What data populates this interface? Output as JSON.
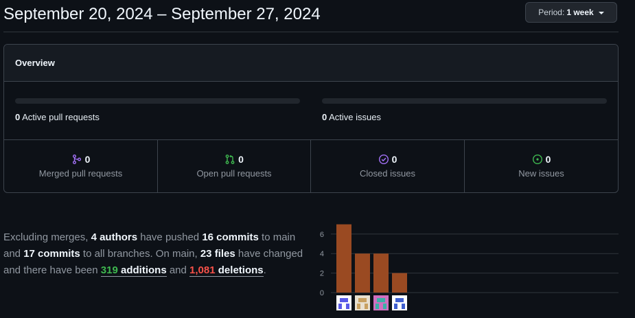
{
  "header": {
    "date_range": "September 20, 2024 – September 27, 2024",
    "period_prefix": "Period:",
    "period_value": "1 week"
  },
  "overview": {
    "title": "Overview",
    "progress": [
      {
        "count": "0",
        "label": "Active pull requests"
      },
      {
        "count": "0",
        "label": "Active issues"
      }
    ],
    "stats": [
      {
        "count": "0",
        "label": "Merged pull requests",
        "icon": "merged-pr-icon",
        "color": "#a371f7"
      },
      {
        "count": "0",
        "label": "Open pull requests",
        "icon": "open-pr-icon",
        "color": "#3fb950"
      },
      {
        "count": "0",
        "label": "Closed issues",
        "icon": "closed-issue-icon",
        "color": "#a371f7"
      },
      {
        "count": "0",
        "label": "New issues",
        "icon": "new-issue-icon",
        "color": "#3fb950"
      }
    ]
  },
  "summary": {
    "t1": "Excluding merges, ",
    "authors": "4 authors",
    "t2": " have pushed ",
    "commits_main": "16 commits",
    "t3": " to main and ",
    "commits_all": "17 commits",
    "t4": " to all branches. On main, ",
    "files": "23 files",
    "t5": " have changed and there have been ",
    "additions_num": "319",
    "additions_word": "additions",
    "t6": " and ",
    "deletions_num": "1,081",
    "deletions_word": "deletions",
    "t7": "."
  },
  "chart_data": {
    "type": "bar",
    "title": "",
    "xlabel": "",
    "ylabel": "",
    "categories": [
      "author-1",
      "author-2",
      "author-3",
      "author-4"
    ],
    "values": [
      7,
      4,
      4,
      2
    ],
    "ylim": [
      0,
      7
    ],
    "yticks": [
      0,
      2,
      4,
      6
    ],
    "grid": true,
    "bar_color": "#9a4a22"
  }
}
